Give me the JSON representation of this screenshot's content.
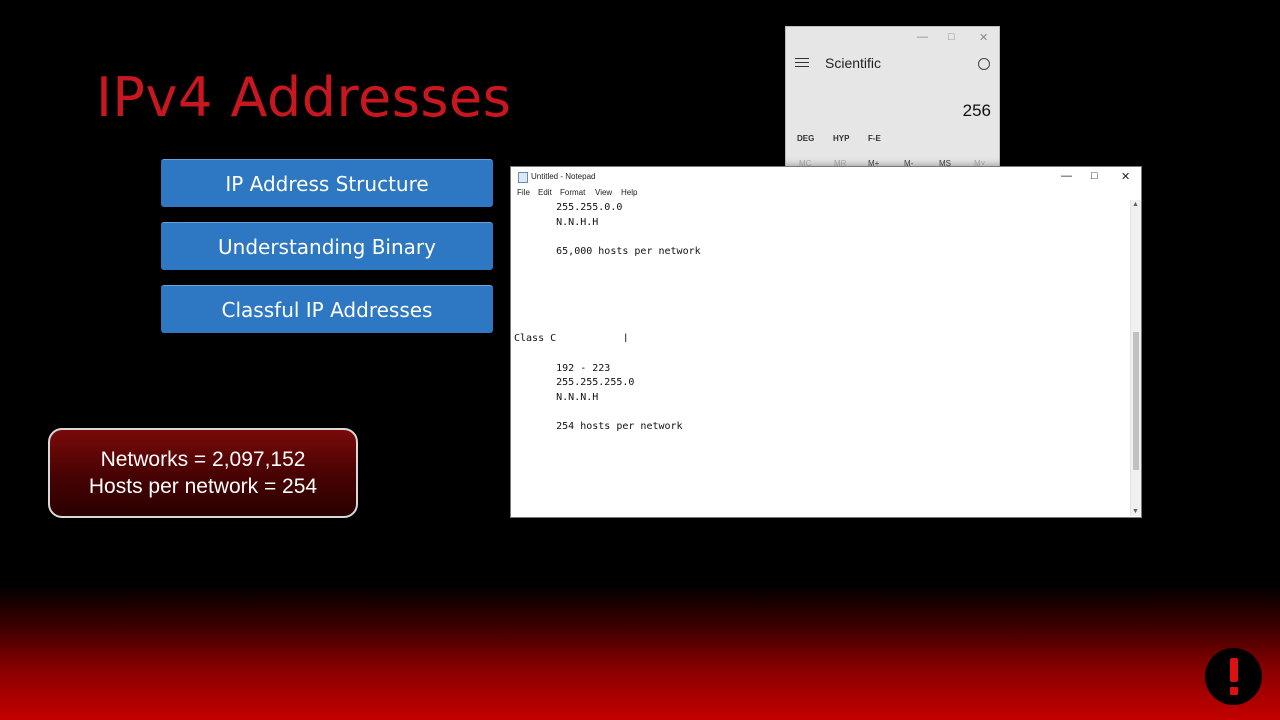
{
  "slide": {
    "title": "IPv4 Addresses",
    "topics": [
      "IP Address Structure",
      "Understanding Binary",
      "Classful IP Addresses"
    ],
    "info_lines": [
      "Networks = 2,097,152",
      "Hosts per network = 254"
    ]
  },
  "calculator": {
    "mode": "Scientific",
    "display": "256",
    "function_buttons": [
      "DEG",
      "HYP",
      "F-E"
    ],
    "memory_buttons": [
      "MC",
      "MR",
      "M+",
      "M-",
      "MS",
      "M˅"
    ]
  },
  "notepad": {
    "title": "Untitled - Notepad",
    "menu": [
      "File",
      "Edit",
      "Format",
      "View",
      "Help"
    ],
    "lines": [
      "       255.255.0.0",
      "       N.N.H.H",
      "",
      "       65,000 hosts per network",
      "",
      "",
      "",
      "",
      "",
      "Class C",
      "",
      "       192 - 223",
      "       255.255.255.0",
      "       N.N.N.H",
      "",
      "       254 hosts per network"
    ]
  },
  "colors": {
    "accent_red": "#c8171e",
    "topic_blue": "#2e77c2"
  }
}
